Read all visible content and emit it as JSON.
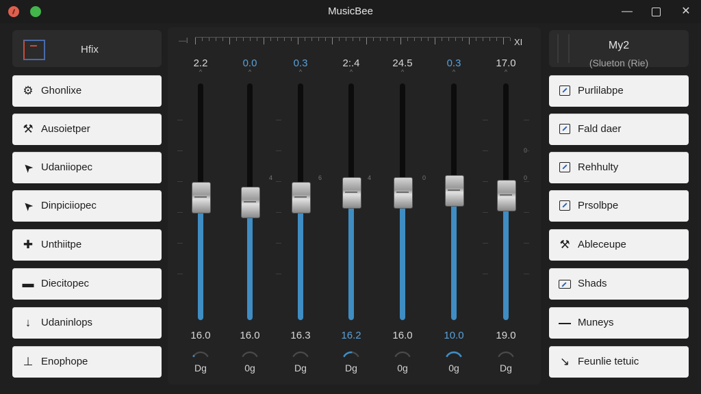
{
  "window": {
    "title": "MusicBee",
    "controls": {
      "minimize": "—",
      "maximize": "",
      "close": "✕"
    }
  },
  "left_panel": {
    "header": {
      "title": "Hfix",
      "icon": "app-logo-icon"
    },
    "items": [
      {
        "label": "Ghonlixe",
        "icon": "gear-icon"
      },
      {
        "label": "Ausoietper",
        "icon": "hammer-icon"
      },
      {
        "label": "Udaniiopec",
        "icon": "cursor-icon"
      },
      {
        "label": "Dinpiciiopec",
        "icon": "cursor-icon"
      },
      {
        "label": "Unthiitpe",
        "icon": "puzzle-icon"
      },
      {
        "label": "Diecitopec",
        "icon": "minus-icon"
      },
      {
        "label": "Udaninlops",
        "icon": "arrow-down-icon"
      },
      {
        "label": "Enophope",
        "icon": "pin-icon"
      }
    ]
  },
  "mixer": {
    "ruler_left": "—l",
    "ruler_right": "XI",
    "channels": [
      {
        "top_value": "2.2",
        "top_color": "#d8d8d8",
        "level": 0.52,
        "bottom_value": "16.0",
        "bottom_color": "#d8d8d8",
        "unit": "Dg",
        "dial": 0.1
      },
      {
        "top_value": "0.0",
        "top_color": "#5aa0d6",
        "level": 0.5,
        "bottom_value": "16.0",
        "bottom_color": "#d8d8d8",
        "unit": "0g",
        "dial": 0.0
      },
      {
        "top_value": "0.3",
        "top_color": "#5aa0d6",
        "level": 0.52,
        "bottom_value": "16.3",
        "bottom_color": "#d8d8d8",
        "unit": "Dg",
        "dial": 0.0
      },
      {
        "top_value": "2:.4",
        "top_color": "#d8d8d8",
        "level": 0.54,
        "bottom_value": "16.2",
        "bottom_color": "#5aa0d6",
        "unit": "Dg",
        "dial": 0.55
      },
      {
        "top_value": "24.5",
        "top_color": "#d8d8d8",
        "level": 0.54,
        "bottom_value": "16.0",
        "bottom_color": "#d8d8d8",
        "unit": "0g",
        "dial": 0.0
      },
      {
        "top_value": "0.3",
        "top_color": "#5aa0d6",
        "level": 0.55,
        "bottom_value": "10.0",
        "bottom_color": "#5aa0d6",
        "unit": "0g",
        "dial": 1.0
      },
      {
        "top_value": "17.0",
        "top_color": "#d8d8d8",
        "level": 0.53,
        "bottom_value": "19.0",
        "bottom_color": "#d8d8d8",
        "unit": "Dg",
        "dial": 0.0
      }
    ],
    "scale": {
      "labels": [
        "4",
        "6",
        "4",
        "0",
        "0",
        "0"
      ]
    }
  },
  "right_panel": {
    "header": {
      "title": "My2",
      "subtitle": "(Slueton (Rie)"
    },
    "items": [
      {
        "label": "Purlilabpe",
        "icon": "edit-icon"
      },
      {
        "label": "Fald daer",
        "icon": "edit-icon"
      },
      {
        "label": "Rehhulty",
        "icon": "edit-icon"
      },
      {
        "label": "Prsolbpe",
        "icon": "edit-icon"
      },
      {
        "label": "Ableceupe",
        "icon": "pin-icon"
      },
      {
        "label": "Shads",
        "icon": "window-icon"
      },
      {
        "label": "Muneys",
        "icon": "menu-icon"
      },
      {
        "label": "Feunlie tetuic",
        "icon": "curve-icon"
      }
    ]
  },
  "colors": {
    "accent": "#3f8dc3",
    "accent_text": "#5aa0d6",
    "background": "#1f1f20",
    "panel": "#232324",
    "item_bg": "#f1f1f1"
  }
}
